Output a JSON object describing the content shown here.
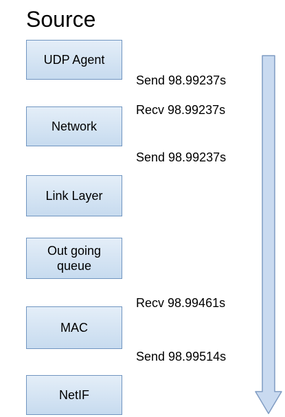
{
  "title": "Source",
  "layers": [
    {
      "label": "UDP Agent"
    },
    {
      "label": "Network"
    },
    {
      "label": "Link Layer"
    },
    {
      "label": "Out going\nqueue"
    },
    {
      "label": "MAC"
    },
    {
      "label": "NetIF"
    }
  ],
  "events": [
    {
      "text": "Send 98.99237s"
    },
    {
      "text": "Recv 98.99237s"
    },
    {
      "text": "Send 98.99237s"
    },
    {
      "text": "Recv 98.99461s"
    },
    {
      "text": "Send 98.99514s"
    }
  ],
  "colors": {
    "box_fill_top": "#e4eef8",
    "box_fill_bottom": "#c7dbef",
    "box_border": "#6f94c0",
    "arrow_fill": "#c9daf0",
    "arrow_stroke": "#7f9bc2"
  }
}
